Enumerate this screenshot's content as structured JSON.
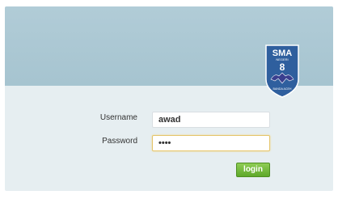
{
  "logo": {
    "school_abbrev": "SMA",
    "school_word": "NEGERI",
    "school_number": "8",
    "bottom_text": "BANDA ACEH",
    "icon": "school-emblem-icon",
    "colors": {
      "shield": "#2f5f9e",
      "shield_border": "#ffffff",
      "emblem": "#3a3f8f"
    }
  },
  "form": {
    "username_label": "Username",
    "username_value": "awad",
    "password_label": "Password",
    "password_value": "awad",
    "login_label": "login"
  },
  "colors": {
    "banner": "#a8c6d2",
    "panel": "#e6eef1",
    "button": "#6bb133",
    "focus_border": "#e5c56b"
  }
}
